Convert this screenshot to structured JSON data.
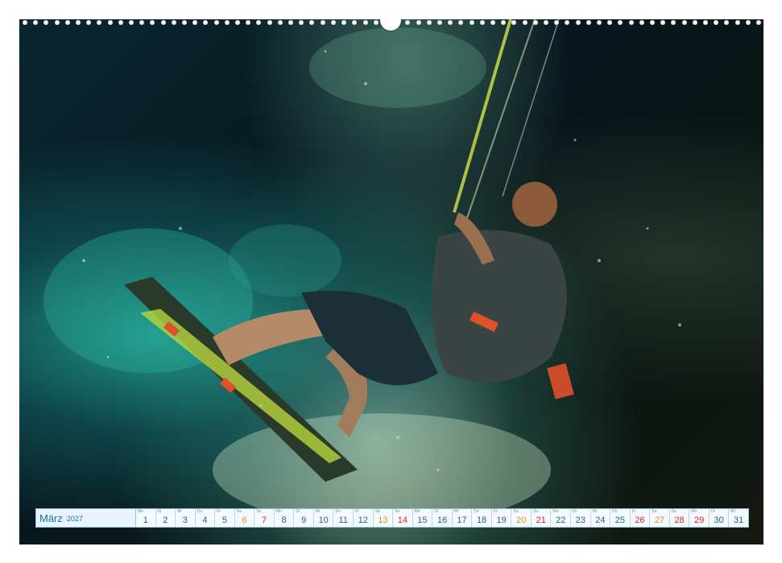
{
  "calendar": {
    "month": "März",
    "year": "2027",
    "days": [
      {
        "n": "1",
        "wd": "Mo",
        "type": "wk"
      },
      {
        "n": "2",
        "wd": "Di",
        "type": "wk"
      },
      {
        "n": "3",
        "wd": "Mi",
        "type": "wk"
      },
      {
        "n": "4",
        "wd": "Do",
        "type": "wk"
      },
      {
        "n": "5",
        "wd": "Fr",
        "type": "wk"
      },
      {
        "n": "6",
        "wd": "Sa",
        "type": "sat"
      },
      {
        "n": "7",
        "wd": "So",
        "type": "sun"
      },
      {
        "n": "8",
        "wd": "Mo",
        "type": "wk"
      },
      {
        "n": "9",
        "wd": "Di",
        "type": "wk"
      },
      {
        "n": "10",
        "wd": "Mi",
        "type": "wk"
      },
      {
        "n": "11",
        "wd": "Do",
        "type": "wk"
      },
      {
        "n": "12",
        "wd": "Fr",
        "type": "wk"
      },
      {
        "n": "13",
        "wd": "Sa",
        "type": "sat"
      },
      {
        "n": "14",
        "wd": "So",
        "type": "sun"
      },
      {
        "n": "15",
        "wd": "Mo",
        "type": "wk"
      },
      {
        "n": "16",
        "wd": "Di",
        "type": "wk"
      },
      {
        "n": "17",
        "wd": "Mi",
        "type": "wk"
      },
      {
        "n": "18",
        "wd": "Do",
        "type": "wk"
      },
      {
        "n": "19",
        "wd": "Fr",
        "type": "wk"
      },
      {
        "n": "20",
        "wd": "Sa",
        "type": "sat"
      },
      {
        "n": "21",
        "wd": "So",
        "type": "sun"
      },
      {
        "n": "22",
        "wd": "Mo",
        "type": "wk"
      },
      {
        "n": "23",
        "wd": "Di",
        "type": "wk"
      },
      {
        "n": "24",
        "wd": "Mi",
        "type": "wk"
      },
      {
        "n": "25",
        "wd": "Do",
        "type": "wk"
      },
      {
        "n": "26",
        "wd": "Fr",
        "type": "hol"
      },
      {
        "n": "27",
        "wd": "Sa",
        "type": "sat"
      },
      {
        "n": "28",
        "wd": "So",
        "type": "sun"
      },
      {
        "n": "29",
        "wd": "Mo",
        "type": "hol"
      },
      {
        "n": "30",
        "wd": "Di",
        "type": "wk"
      },
      {
        "n": "31",
        "wd": "Mi",
        "type": "wk"
      }
    ]
  },
  "colors": {
    "accent": "#1d6fb0",
    "saturday": "#e0901e",
    "sunday": "#d22a2a"
  }
}
